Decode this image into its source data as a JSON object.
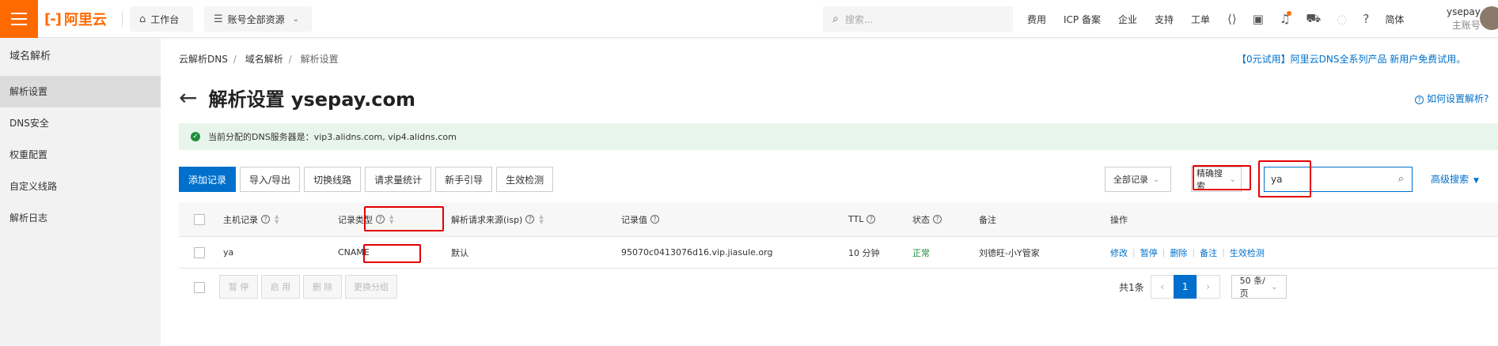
{
  "topbar": {
    "logo_text": "阿里云",
    "workbench": "工作台",
    "resources": "账号全部资源",
    "search_placeholder": "搜索...",
    "links": [
      "费用",
      "ICP 备案",
      "企业",
      "支持",
      "工单"
    ],
    "lang": "简体",
    "username": "ysepay",
    "user_role": "主账号"
  },
  "sidebar": {
    "header": "域名解析",
    "items": [
      "解析设置",
      "DNS安全",
      "权重配置",
      "自定义线路",
      "解析日志"
    ],
    "active": "解析设置"
  },
  "breadcrumb": [
    "云解析DNS",
    "域名解析",
    "解析设置"
  ],
  "promo": "【0元试用】阿里云DNS全系列产品 新用户免费试用。",
  "page_title": "解析设置 ysepay.com",
  "help_link": "如何设置解析?",
  "alert": "当前分配的DNS服务器是：vip3.alidns.com, vip4.alidns.com",
  "toolbar": {
    "buttons": [
      "添加记录",
      "导入/导出",
      "切换线路",
      "请求量统计",
      "新手引导",
      "生效检测"
    ]
  },
  "filters": {
    "record_scope": "全部记录",
    "search_mode": "精确搜索",
    "search_value": "ya",
    "advanced": "高级搜索"
  },
  "table": {
    "headers": {
      "host": "主机记录",
      "type": "记录类型",
      "isp": "解析请求来源(isp)",
      "value": "记录值",
      "ttl": "TTL",
      "status": "状态",
      "remark": "备注",
      "ops": "操作"
    },
    "rows": [
      {
        "host": "ya",
        "type": "CNAME",
        "isp": "默认",
        "value": "95070c0413076d16.vip.jiasule.org",
        "ttl": "10 分钟",
        "status": "正常",
        "remark": "刘德旺-小Y管家",
        "ops": [
          "修改",
          "暂停",
          "删除",
          "备注",
          "生效检测"
        ]
      }
    ]
  },
  "footer": {
    "bulk_buttons": [
      "暂 停",
      "启 用",
      "删 除",
      "更换分组"
    ],
    "total": "共1条",
    "current_page": "1",
    "page_size": "50 条/页"
  },
  "colors": {
    "brand": "#ff6a00",
    "primary": "#0070cc",
    "success": "#1e8e3e",
    "highlight": "#e30000"
  }
}
